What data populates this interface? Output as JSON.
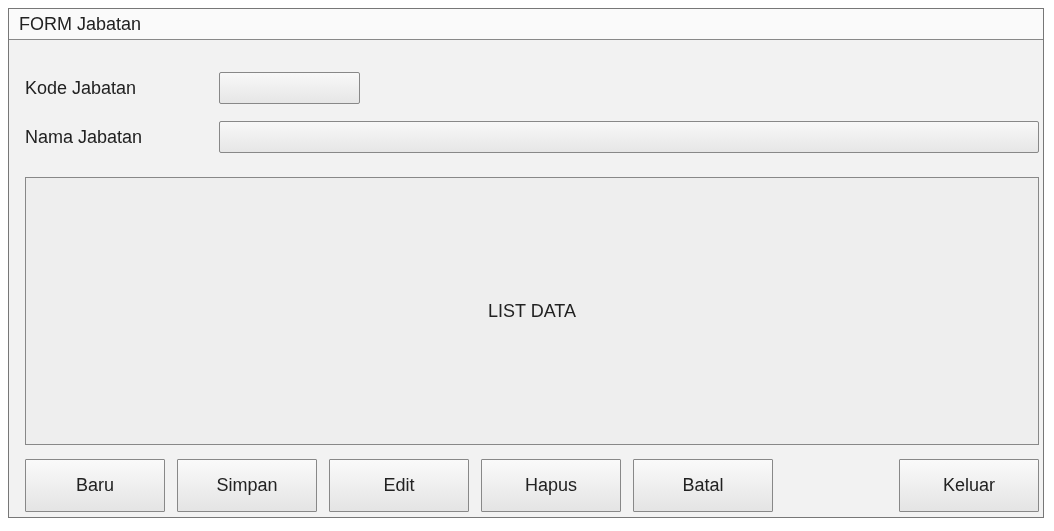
{
  "window": {
    "title": "FORM Jabatan"
  },
  "fields": [
    {
      "label": "Kode Jabatan",
      "kind": "short"
    },
    {
      "label": "Nama Jabatan",
      "kind": "wide"
    }
  ],
  "list": {
    "text": "LIST DATA"
  },
  "buttons": [
    "Baru",
    "Simpan",
    "Edit",
    "Hapus",
    "Batal"
  ],
  "exit_button": "Keluar"
}
